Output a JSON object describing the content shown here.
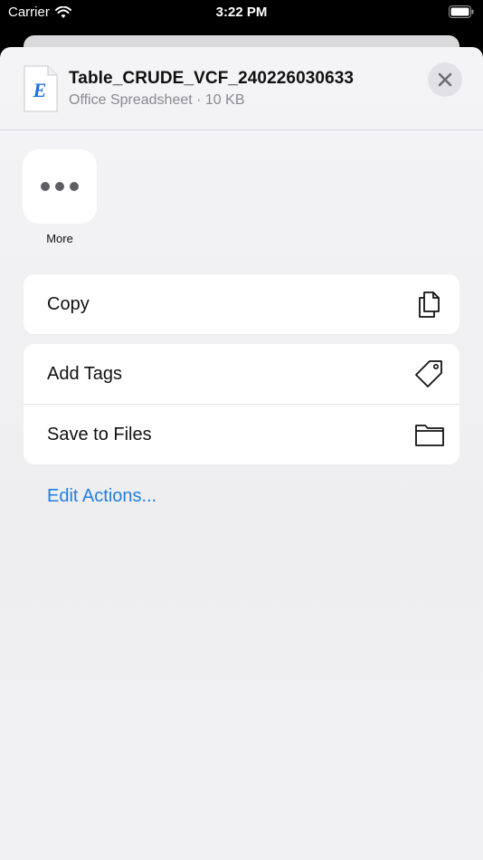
{
  "status_bar": {
    "carrier": "Carrier",
    "time": "3:22 PM"
  },
  "header": {
    "file_name": "Table_CRUDE_VCF_240226030633",
    "file_meta": "Office Spreadsheet · 10 KB",
    "file_icon_letter": "E",
    "close_icon": "close-icon"
  },
  "apps": {
    "more_label": "More"
  },
  "actions": {
    "group1": [
      {
        "label": "Copy",
        "icon": "copy-icon"
      }
    ],
    "group2": [
      {
        "label": "Add Tags",
        "icon": "tag-icon"
      },
      {
        "label": "Save to Files",
        "icon": "folder-icon"
      }
    ],
    "edit_actions": "Edit Actions..."
  },
  "colors": {
    "accent": "#1f7fe0",
    "sheet_bg": "#f4f4f6"
  }
}
